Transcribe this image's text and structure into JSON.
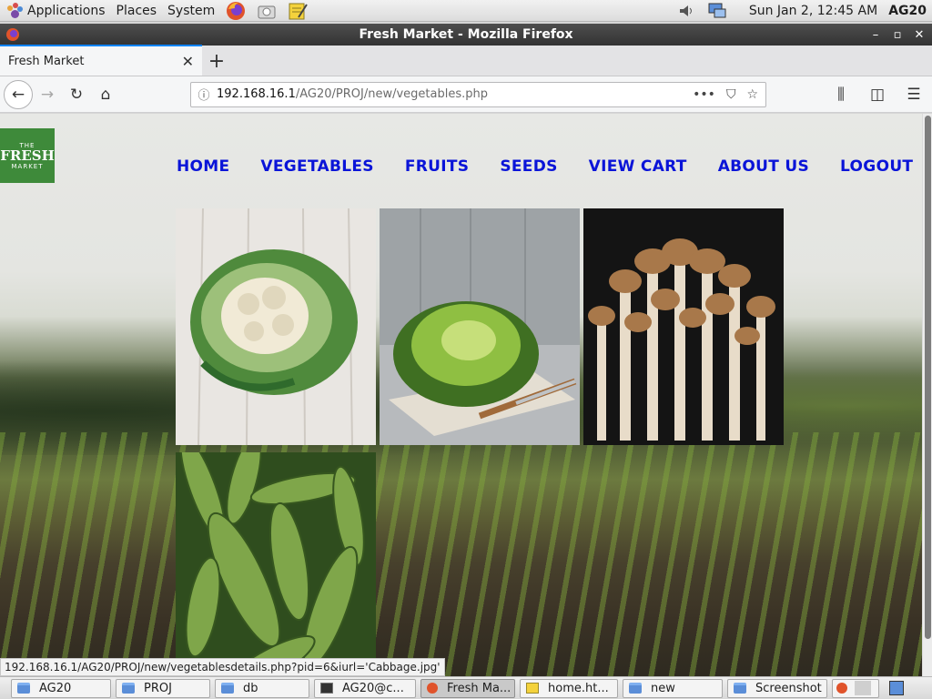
{
  "panel": {
    "applications": "Applications",
    "places": "Places",
    "system": "System",
    "clock": "Sun Jan  2, 12:45 AM",
    "user": "AG20"
  },
  "window": {
    "title": "Fresh Market - Mozilla Firefox"
  },
  "tab": {
    "title": "Fresh Market"
  },
  "url": {
    "host": "192.168.16.1",
    "path": "/AG20/PROJ/new/vegetables.php"
  },
  "site": {
    "logo_top": "THE",
    "logo_mid": "FRESH",
    "logo_bottom": "MARKET",
    "nav": [
      "HOME",
      "VEGETABLES",
      "FRUITS",
      "SEEDS",
      "VIEW CART",
      "ABOUT US",
      "LOGOUT"
    ],
    "products": [
      {
        "name": "Cauliflower"
      },
      {
        "name": "Cabbage"
      },
      {
        "name": "Mushrooms"
      },
      {
        "name": "Cucumber"
      }
    ]
  },
  "status_link": "192.168.16.1/AG20/PROJ/new/vegetablesdetails.php?pid=6&iurl='Cabbage.jpg'",
  "taskbar": [
    {
      "label": "AG20",
      "icon": "folder-icon"
    },
    {
      "label": "PROJ",
      "icon": "folder-icon"
    },
    {
      "label": "db",
      "icon": "folder-icon"
    },
    {
      "label": "AG20@c...",
      "icon": "terminal-icon"
    },
    {
      "label": "Fresh Ma...",
      "icon": "firefox-icon"
    },
    {
      "label": "home.ht...",
      "icon": "text-editor-icon"
    },
    {
      "label": "new",
      "icon": "folder-icon"
    },
    {
      "label": "Screenshot",
      "icon": "folder-icon"
    }
  ],
  "colors": {
    "nav_link": "#0a14d8",
    "logo_green": "#3e8a3a",
    "tab_accent": "#0a84ff"
  }
}
